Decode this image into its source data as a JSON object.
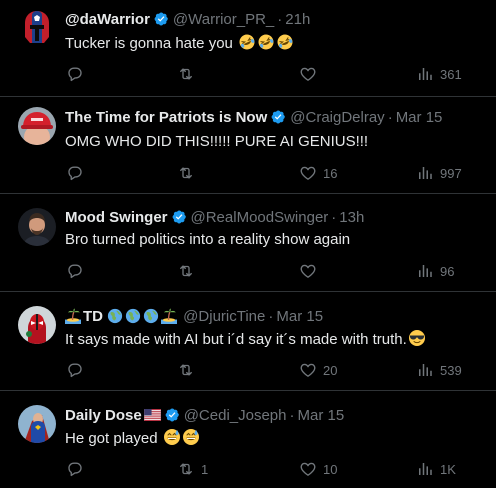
{
  "colors": {
    "background": "#000000",
    "text": "#e7e9ea",
    "muted": "#71767b",
    "divider": "#2f3336",
    "verified": "#1d9bf0"
  },
  "tweets": [
    {
      "name": "@daWarrior",
      "handle": "@Warrior_PR_",
      "separator": "·",
      "time": "21h",
      "text": "Tucker is gonna hate you",
      "emojis": [
        "rolling-on-floor-laughing",
        "rolling-on-floor-laughing",
        "rolling-on-floor-laughing"
      ],
      "reply_count": "",
      "retweet_count": "",
      "like_count": "",
      "view_count": "361"
    },
    {
      "name": "The Time for Patriots is Now",
      "handle": "@CraigDelray",
      "separator": "·",
      "time": "Mar 15",
      "text": "OMG WHO DID THIS!!!!! PURE AI GENIUS!!!",
      "reply_count": "",
      "retweet_count": "",
      "like_count": "16",
      "view_count": "997"
    },
    {
      "name": "Mood Swinger",
      "handle": "@RealMoodSwinger",
      "separator": "·",
      "time": "13h",
      "text": "Bro turned politics into a reality show again",
      "reply_count": "",
      "retweet_count": "",
      "like_count": "",
      "view_count": "96"
    },
    {
      "name": "TD",
      "name_emojis": [
        "island-icon",
        "globe-icon",
        "globe-icon",
        "globe-icon",
        "island-icon"
      ],
      "handle": "@DjuricTine",
      "separator": "·",
      "time": "Mar 15",
      "text": "It says made with AI but i´d say it´s made with truth.",
      "emojis": [
        "sunglasses-face"
      ],
      "reply_count": "",
      "retweet_count": "",
      "like_count": "20",
      "view_count": "539"
    },
    {
      "name": "Daily Dose",
      "name_emojis": [
        "us-flag-icon"
      ],
      "handle": "@Cedi_Joseph",
      "separator": "·",
      "time": "Mar 15",
      "text": "He got played",
      "emojis": [
        "grinning-sweat-face",
        "grinning-sweat-face"
      ],
      "reply_count": "",
      "retweet_count": "1",
      "like_count": "10",
      "view_count": "1K"
    }
  ]
}
